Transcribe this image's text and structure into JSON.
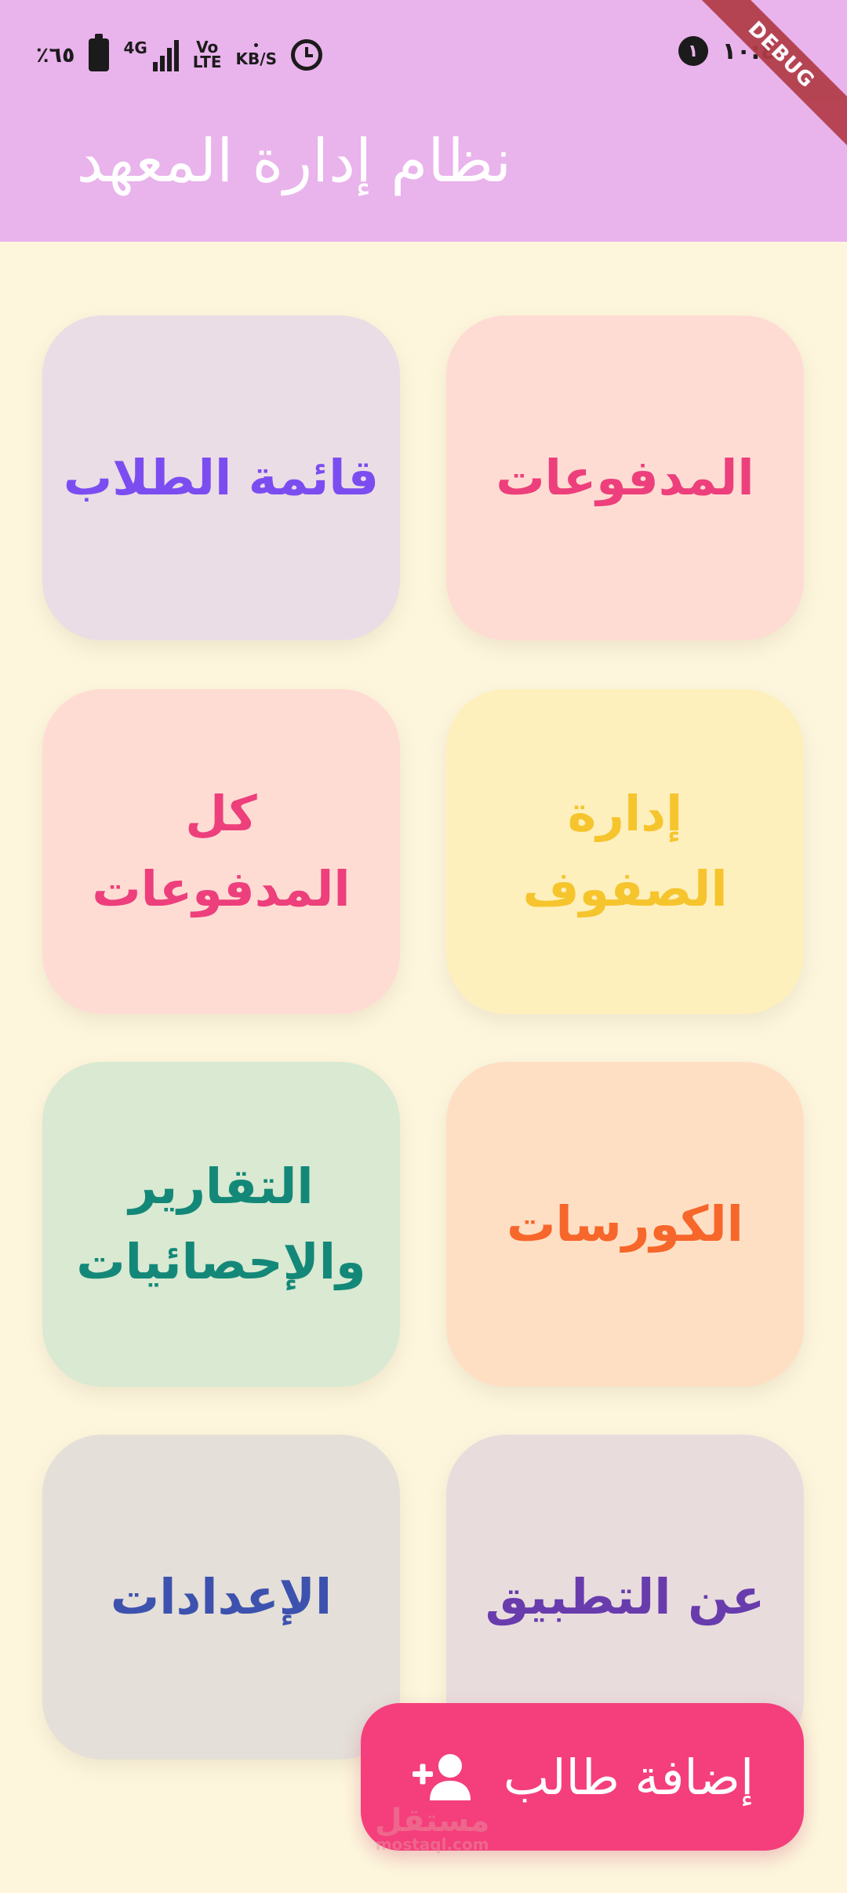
{
  "status_bar": {
    "battery_percent": "٪٦٥",
    "network": "4G",
    "volte_top": "Vo",
    "volte_bottom": "LTE",
    "speed_unit": "KB/S",
    "notification_count": "١",
    "time": "١٠:٤٠"
  },
  "debug_banner": "DEBUG",
  "app_bar": {
    "title": "نظام إدارة المعهد"
  },
  "cards": [
    {
      "id": "payments",
      "label": "المدفوعات",
      "bg": "#fedcd3",
      "fg": "#ed3f7c"
    },
    {
      "id": "students",
      "label": "قائمة الطلاب",
      "bg": "#ebdde5",
      "fg": "#7b4df0"
    },
    {
      "id": "classes",
      "label": "إدارة\nالصفوف",
      "bg": "#fef0bd",
      "fg": "#f6c42d"
    },
    {
      "id": "all-payments",
      "label": "كل\nالمدفوعات",
      "bg": "#fedcd3",
      "fg": "#ed3f7c"
    },
    {
      "id": "courses",
      "label": "الكورسات",
      "bg": "#fedfc4",
      "fg": "#f7662a"
    },
    {
      "id": "reports",
      "label": "التقارير\nوالإحصائيات",
      "bg": "#d9e9d2",
      "fg": "#138878"
    },
    {
      "id": "about",
      "label": "عن التطبيق",
      "bg": "#e9dcdd",
      "fg": "#683cad"
    },
    {
      "id": "settings",
      "label": "الإعدادات",
      "bg": "#e4dfd8",
      "fg": "#3c52ae"
    }
  ],
  "fab": {
    "label": "إضافة طالب",
    "icon": "person-add-icon",
    "color": "#f43f7c"
  },
  "watermark": {
    "text": "مستقل",
    "sub": "mostaql.com"
  },
  "colors": {
    "app_bar": "#e9b3ec",
    "background": "#fdf6dd"
  }
}
